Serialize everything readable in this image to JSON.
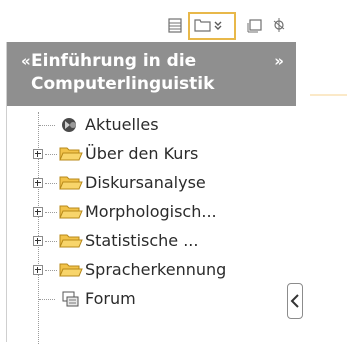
{
  "toolbar": {
    "buttons": [
      "list-view-icon",
      "folder-dropdown-icon",
      "window-icon",
      "pin-icon"
    ]
  },
  "panel": {
    "collapse_glyph": "«",
    "title": "Einführung in die Computerlinguistik",
    "expand_glyph": "»"
  },
  "tree": [
    {
      "label": "Aktuelles",
      "icon": "forum-news-icon",
      "expandable": false
    },
    {
      "label": "Über den Kurs",
      "icon": "folder-icon",
      "expandable": true
    },
    {
      "label": "Diskursanalyse",
      "icon": "folder-icon",
      "expandable": true
    },
    {
      "label": "Morphologisch...",
      "icon": "folder-icon",
      "expandable": true
    },
    {
      "label": "Statistische ...",
      "icon": "folder-icon",
      "expandable": true
    },
    {
      "label": "Spracherkennung",
      "icon": "folder-icon",
      "expandable": true
    },
    {
      "label": "Forum",
      "icon": "forum-icon",
      "expandable": false
    }
  ],
  "colors": {
    "header_bg": "#8f8f8f",
    "folder_yellow": "#f2c34a",
    "highlight_border": "#e8b84a"
  }
}
